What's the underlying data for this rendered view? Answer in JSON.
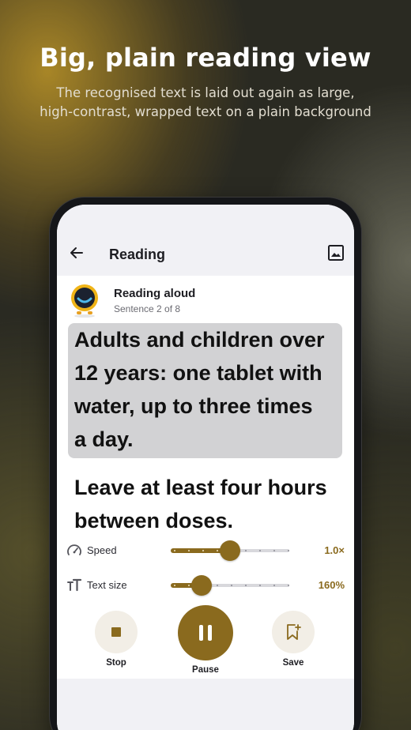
{
  "hero": {
    "title": "Big, plain reading view",
    "subtitle_line1": "The recognised text is laid out again as large,",
    "subtitle_line2": "high-contrast, wrapped text on a plain background"
  },
  "appbar": {
    "title": "Reading",
    "back_icon": "arrow-left-icon",
    "image_icon": "image-icon"
  },
  "reader": {
    "status_title": "Reading aloud",
    "status_sub": "Sentence 2 of 8",
    "sentences": [
      {
        "lines": [
          "Adults and children over",
          "12 years: one tablet with",
          "water, up to three times",
          "a day."
        ],
        "active": true
      },
      {
        "lines": [
          "Leave at least four hours",
          "between doses."
        ],
        "active": false
      }
    ]
  },
  "controls": {
    "speed": {
      "label": "Speed",
      "value_text": "1.0×",
      "level": 0.5,
      "icon": "speedometer-icon"
    },
    "text_size": {
      "label": "Text size",
      "value_text": "160%",
      "level": 0.26,
      "icon": "text-size-icon"
    }
  },
  "buttons": {
    "stop": {
      "label": "Stop",
      "icon": "stop-icon"
    },
    "pause": {
      "label": "Pause",
      "icon": "pause-icon"
    },
    "save": {
      "label": "Save",
      "icon": "bookmark-add-icon"
    }
  },
  "colors": {
    "accent": "#8a6a1e",
    "highlight": "#d2d2d4"
  }
}
